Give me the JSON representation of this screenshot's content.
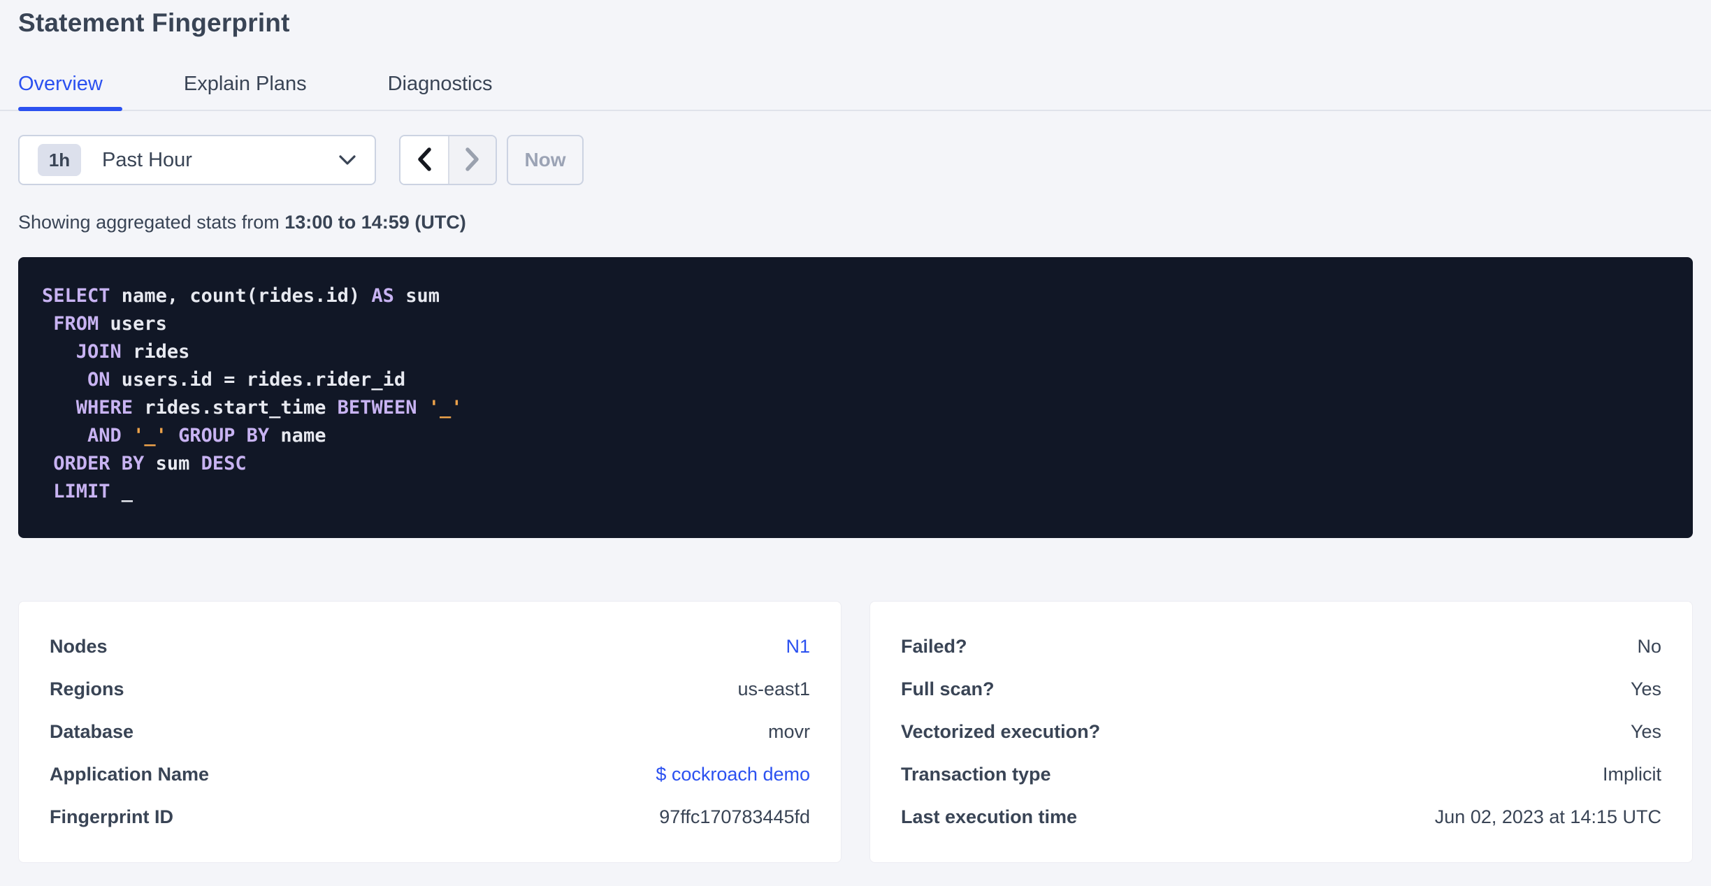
{
  "page": {
    "title": "Statement Fingerprint"
  },
  "tabs": [
    {
      "label": "Overview",
      "active": true
    },
    {
      "label": "Explain Plans",
      "active": false
    },
    {
      "label": "Diagnostics",
      "active": false
    }
  ],
  "time_picker": {
    "badge": "1h",
    "label": "Past Hour",
    "now_label": "Now",
    "icons": {
      "dropdown": "chevron-down-icon",
      "prev": "chevron-left-icon",
      "next": "chevron-right-icon"
    },
    "prev_enabled": true,
    "next_enabled": false
  },
  "stats_line": {
    "prefix": "Showing aggregated stats from ",
    "range": "13:00 to 14:59 (UTC)"
  },
  "sql": {
    "lines": [
      [
        {
          "c": "kw",
          "t": "SELECT"
        },
        {
          "c": "pl",
          "t": " name, count(rides.id) "
        },
        {
          "c": "kw",
          "t": "AS"
        },
        {
          "c": "pl",
          "t": " sum"
        }
      ],
      [
        {
          "c": "pl",
          "t": " "
        },
        {
          "c": "kw",
          "t": "FROM"
        },
        {
          "c": "pl",
          "t": " users"
        }
      ],
      [
        {
          "c": "pl",
          "t": "   "
        },
        {
          "c": "kw",
          "t": "JOIN"
        },
        {
          "c": "pl",
          "t": " rides"
        }
      ],
      [
        {
          "c": "pl",
          "t": "    "
        },
        {
          "c": "kw",
          "t": "ON"
        },
        {
          "c": "pl",
          "t": " users.id = rides.rider_id"
        }
      ],
      [
        {
          "c": "pl",
          "t": "   "
        },
        {
          "c": "kw",
          "t": "WHERE"
        },
        {
          "c": "pl",
          "t": " rides.start_time "
        },
        {
          "c": "kw",
          "t": "BETWEEN"
        },
        {
          "c": "pl",
          "t": " "
        },
        {
          "c": "str",
          "t": "'_'"
        }
      ],
      [
        {
          "c": "pl",
          "t": "    "
        },
        {
          "c": "kw",
          "t": "AND"
        },
        {
          "c": "pl",
          "t": " "
        },
        {
          "c": "str",
          "t": "'_'"
        },
        {
          "c": "pl",
          "t": " "
        },
        {
          "c": "kw",
          "t": "GROUP BY"
        },
        {
          "c": "pl",
          "t": " name"
        }
      ],
      [
        {
          "c": "pl",
          "t": " "
        },
        {
          "c": "kw",
          "t": "ORDER BY"
        },
        {
          "c": "pl",
          "t": " sum "
        },
        {
          "c": "kw",
          "t": "DESC"
        }
      ],
      [
        {
          "c": "pl",
          "t": " "
        },
        {
          "c": "kw",
          "t": "LIMIT"
        },
        {
          "c": "pl",
          "t": " _"
        }
      ]
    ]
  },
  "cards": {
    "left": {
      "rows": [
        {
          "label": "Nodes",
          "value": "N1",
          "link": true
        },
        {
          "label": "Regions",
          "value": "us-east1",
          "link": false
        },
        {
          "label": "Database",
          "value": "movr",
          "link": false
        },
        {
          "label": "Application Name",
          "value": "$ cockroach demo",
          "link": true
        },
        {
          "label": "Fingerprint ID",
          "value": "97ffc170783445fd",
          "link": false
        }
      ]
    },
    "right": {
      "rows": [
        {
          "label": "Failed?",
          "value": "No",
          "link": false
        },
        {
          "label": "Full scan?",
          "value": "Yes",
          "link": false
        },
        {
          "label": "Vectorized execution?",
          "value": "Yes",
          "link": false
        },
        {
          "label": "Transaction type",
          "value": "Implicit",
          "link": false
        },
        {
          "label": "Last execution time",
          "value": "Jun 02, 2023 at 14:15 UTC",
          "link": false
        }
      ]
    }
  },
  "colors": {
    "accent_blue": "#2b51f0",
    "text_dark": "#394455",
    "disabled_text": "#9ba3b5",
    "page_background": "#f4f5f9",
    "code_background": "#111726",
    "code_keyword": "#c8b3f2",
    "code_string": "#eda24a",
    "code_plain": "#e7e9f0"
  }
}
